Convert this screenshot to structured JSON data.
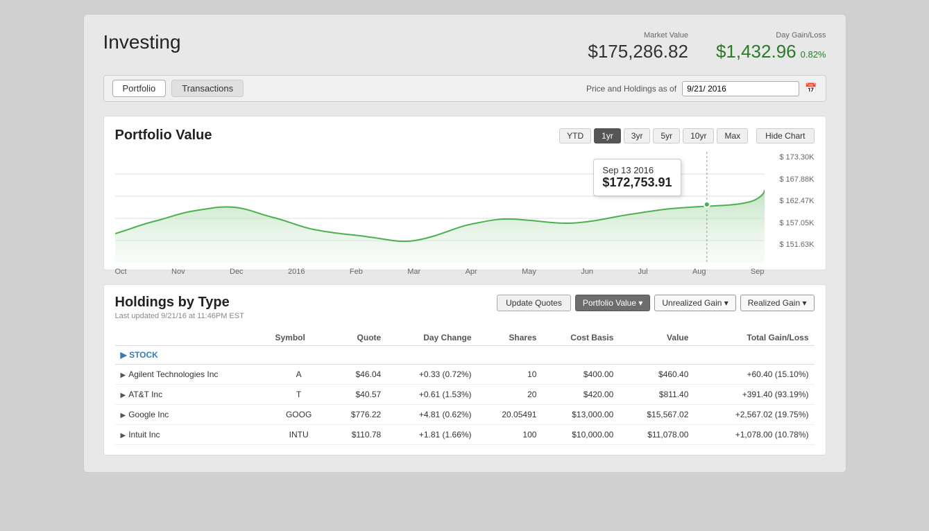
{
  "app": {
    "title": "Investing"
  },
  "header": {
    "market_value_label": "Market Value",
    "market_value": "$175,286.82",
    "day_gain_label": "Day Gain/Loss",
    "day_gain": "$1,432.96",
    "day_gain_pct": "0.82%"
  },
  "tabs": {
    "portfolio_label": "Portfolio",
    "transactions_label": "Transactions",
    "date_label": "Price and Holdings as of",
    "date_value": "9/21/ 2016"
  },
  "chart": {
    "title": "Portfolio Value",
    "periods": [
      "YTD",
      "1yr",
      "3yr",
      "5yr",
      "10yr",
      "Max"
    ],
    "active_period": "1yr",
    "hide_chart_label": "Hide Chart",
    "tooltip": {
      "date": "Sep 13 2016",
      "value": "$172,753.91"
    },
    "y_labels": [
      "$ 173.30K",
      "$ 167.88K",
      "$ 162.47K",
      "$ 157.05K",
      "$ 151.63K"
    ],
    "x_labels": [
      "Oct",
      "Nov",
      "Dec",
      "2016",
      "Feb",
      "Mar",
      "Apr",
      "May",
      "Jun",
      "Jul",
      "Aug",
      "Sep"
    ]
  },
  "holdings": {
    "title": "Holdings by Type",
    "subtitle": "Last updated 9/21/16 at 11:46PM EST",
    "update_quotes_label": "Update Quotes",
    "portfolio_value_label": "Portfolio Value ▾",
    "unrealized_gain_label": "Unrealized Gain ▾",
    "realized_gain_label": "Realized Gain ▾",
    "columns": [
      "Symbol",
      "Quote",
      "Day Change",
      "Shares",
      "Cost Basis",
      "Value",
      "Total Gain/Loss"
    ],
    "stock_section_label": "▶ STOCK",
    "rows": [
      {
        "name": "Agilent Technologies Inc",
        "symbol": "A",
        "quote": "$46.04",
        "day_change": "+0.33 (0.72%)",
        "shares": "10",
        "cost_basis": "$400.00",
        "value": "$460.40",
        "total_gain": "+60.40 (15.10%)"
      },
      {
        "name": "AT&T Inc",
        "symbol": "T",
        "quote": "$40.57",
        "day_change": "+0.61 (1.53%)",
        "shares": "20",
        "cost_basis": "$420.00",
        "value": "$811.40",
        "total_gain": "+391.40 (93.19%)"
      },
      {
        "name": "Google Inc",
        "symbol": "GOOG",
        "quote": "$776.22",
        "day_change": "+4.81 (0.62%)",
        "shares": "20.05491",
        "cost_basis": "$13,000.00",
        "value": "$15,567.02",
        "total_gain": "+2,567.02 (19.75%)"
      },
      {
        "name": "Intuit Inc",
        "symbol": "INTU",
        "quote": "$110.78",
        "day_change": "+1.81 (1.66%)",
        "shares": "100",
        "cost_basis": "$10,000.00",
        "value": "$11,078.00",
        "total_gain": "+1,078.00 (10.78%)"
      }
    ]
  }
}
